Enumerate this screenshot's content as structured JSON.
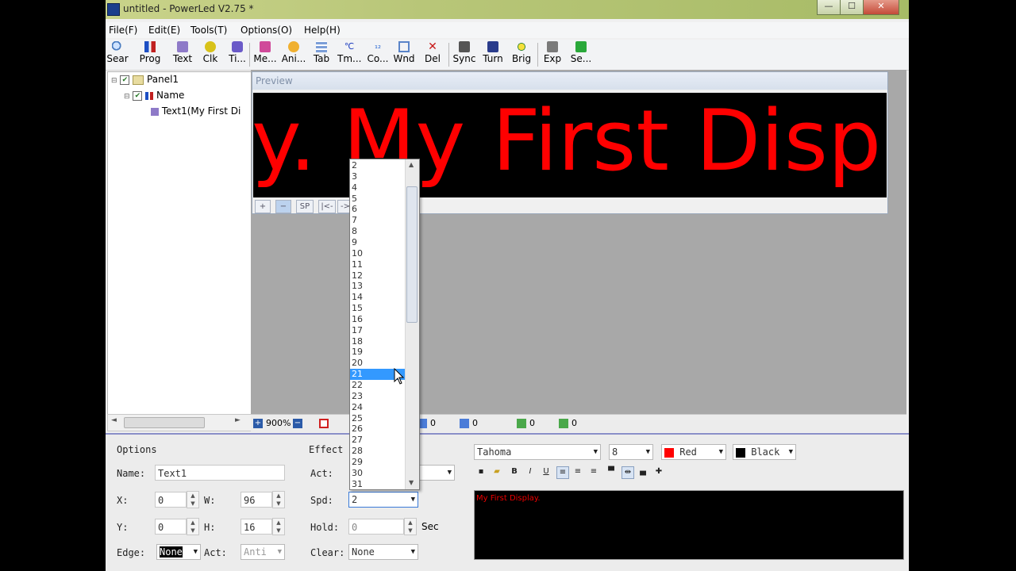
{
  "window": {
    "title": "untitled - PowerLed V2.75 *",
    "controls": [
      "—",
      "☐",
      "✕"
    ]
  },
  "menu": [
    "File(F)",
    "Edit(E)",
    "Tools(T)",
    "Options(O)",
    "Help(H)"
  ],
  "toolbar": [
    {
      "label": "Sear",
      "icon": "search-icon"
    },
    {
      "label": "Prog",
      "icon": "program-icon"
    },
    {
      "label": "Text",
      "icon": "text-icon"
    },
    {
      "label": "Clk",
      "icon": "clock-icon"
    },
    {
      "label": "Ti...",
      "icon": "timer-icon"
    },
    {
      "label": "Me...",
      "icon": "media-icon"
    },
    {
      "label": "Ani...",
      "icon": "animation-icon"
    },
    {
      "label": "Tab",
      "icon": "table-icon"
    },
    {
      "label": "Tm...",
      "icon": "temperature-icon"
    },
    {
      "label": "Co...",
      "icon": "counter-icon"
    },
    {
      "label": "Wnd",
      "icon": "window-icon"
    },
    {
      "label": "Del",
      "icon": "delete-icon"
    },
    {
      "label": "Sync",
      "icon": "sync-icon"
    },
    {
      "label": "Turn",
      "icon": "turn-icon"
    },
    {
      "label": "Brig",
      "icon": "brightness-icon"
    },
    {
      "label": "Exp",
      "icon": "export-icon"
    },
    {
      "label": "Se...",
      "icon": "send-icon"
    }
  ],
  "tree": {
    "panel": "Panel1",
    "group": "Name",
    "item": "Text1(My First Di"
  },
  "preview": {
    "title": "Preview",
    "led_text": "y. My First Displa",
    "led_color": "#ff0000",
    "tools": [
      "+",
      "−",
      "SP",
      "|<-",
      "->"
    ]
  },
  "status": {
    "zoom": "900%",
    "values": [
      "0",
      "0",
      "0",
      "0"
    ]
  },
  "options": {
    "header": "Options",
    "name_label": "Name:",
    "name_value": "Text1",
    "x_label": "X:",
    "x_value": "0",
    "w_label": "W:",
    "w_value": "96",
    "y_label": "Y:",
    "y_value": "0",
    "h_label": "H:",
    "h_value": "16",
    "edge_label": "Edge:",
    "edge_value": "None",
    "act_label": "Act:",
    "act_value": "Anti"
  },
  "effect": {
    "header": "Effect",
    "act_label": "Act:",
    "spd_label": "Spd:",
    "spd_value": "2",
    "hold_label": "Hold:",
    "hold_value": "0",
    "hold_unit": "Sec",
    "clear_label": "Clear:",
    "clear_value": "None"
  },
  "font": {
    "family": "Tahoma",
    "size": "8",
    "fore_color_name": "Red",
    "fore_color": "#ff0000",
    "back_color_name": "Black",
    "back_color": "#000000"
  },
  "editor": {
    "text": "My First Display."
  },
  "dropdown": {
    "items": [
      "2",
      "3",
      "4",
      "5",
      "6",
      "7",
      "8",
      "9",
      "10",
      "11",
      "12",
      "13",
      "14",
      "15",
      "16",
      "17",
      "18",
      "19",
      "20",
      "21",
      "22",
      "23",
      "24",
      "25",
      "26",
      "27",
      "28",
      "29",
      "30",
      "31"
    ],
    "highlighted": "21"
  }
}
